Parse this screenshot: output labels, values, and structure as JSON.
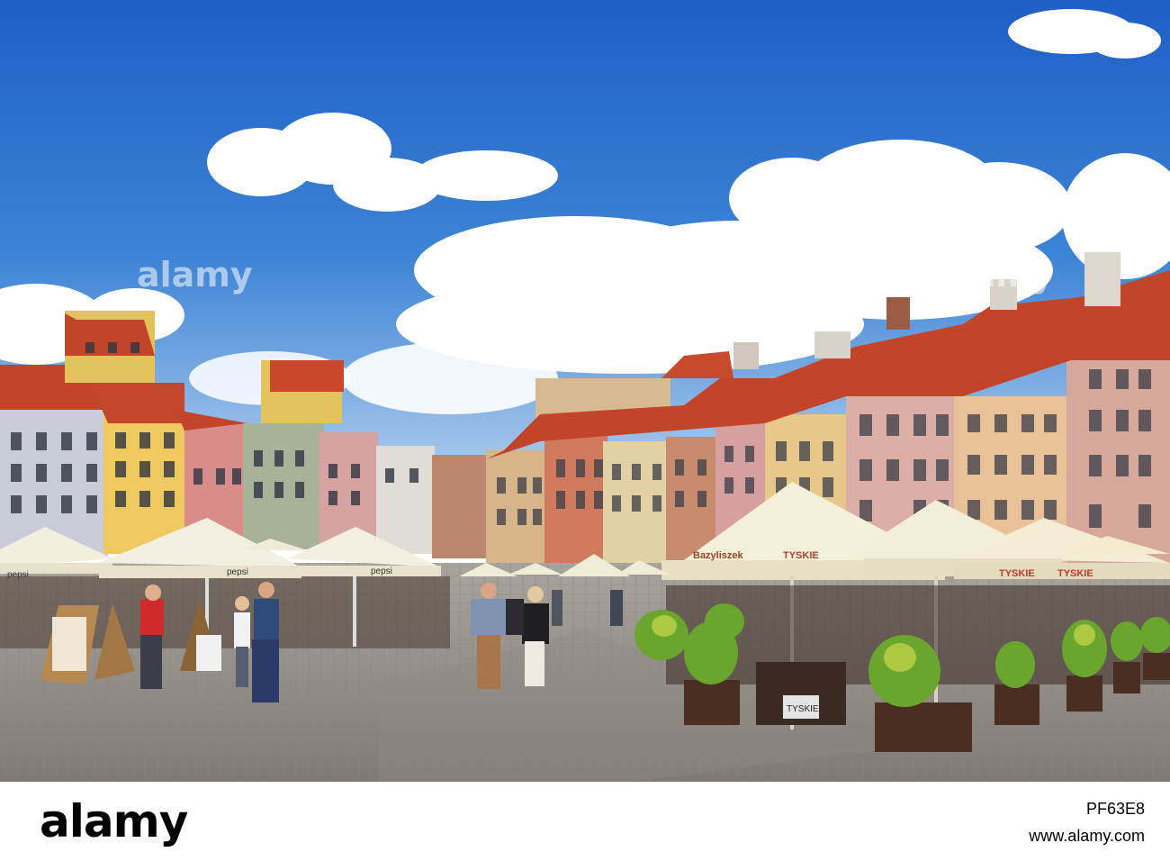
{
  "photo": {
    "subject": "",
    "watermarks": [
      "alamy",
      "alamy"
    ],
    "umbrella_logos": [
      "pepsi",
      "pepsi",
      "pepsi",
      "TYSKIE",
      "TYSKIE",
      "TYSKIE",
      "Bazyliszek"
    ],
    "fence_sign": "TYSKIE"
  },
  "footer": {
    "logo": "alamy",
    "image_id": "PF63E8",
    "site": "www.alamy.com"
  },
  "colors": {
    "sky_top": "#1f63c9",
    "sky_bottom": "#8cb7e6",
    "cloud": "#ffffff",
    "roof": "#c2452a",
    "umbrella": "#f4efd8",
    "cobblestone": "#9a9690",
    "plant": "#6aa52d"
  }
}
